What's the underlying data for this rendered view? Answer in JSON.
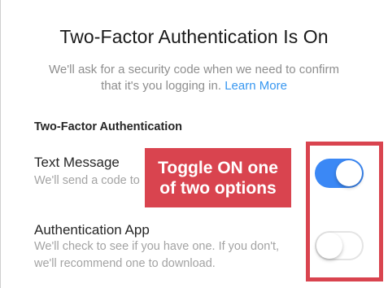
{
  "header": {
    "title": "Two-Factor Authentication Is On",
    "description": "We'll ask for a security code when we need to confirm that it's you logging in.",
    "learn_more": "Learn More"
  },
  "section": {
    "heading": "Two-Factor Authentication"
  },
  "options": [
    {
      "title": "Text Message",
      "description": "We'll send a code to",
      "enabled": true
    },
    {
      "title": "Authentication App",
      "description": "We'll check to see if you have one. If you don't, we'll recommend one to download.",
      "enabled": false
    }
  ],
  "annotation": {
    "callout_line1": "Toggle ON one",
    "callout_line2": "of two options",
    "color": "#d9444f"
  },
  "colors": {
    "toggle_on": "#3b88f5",
    "link": "#3897f0"
  }
}
